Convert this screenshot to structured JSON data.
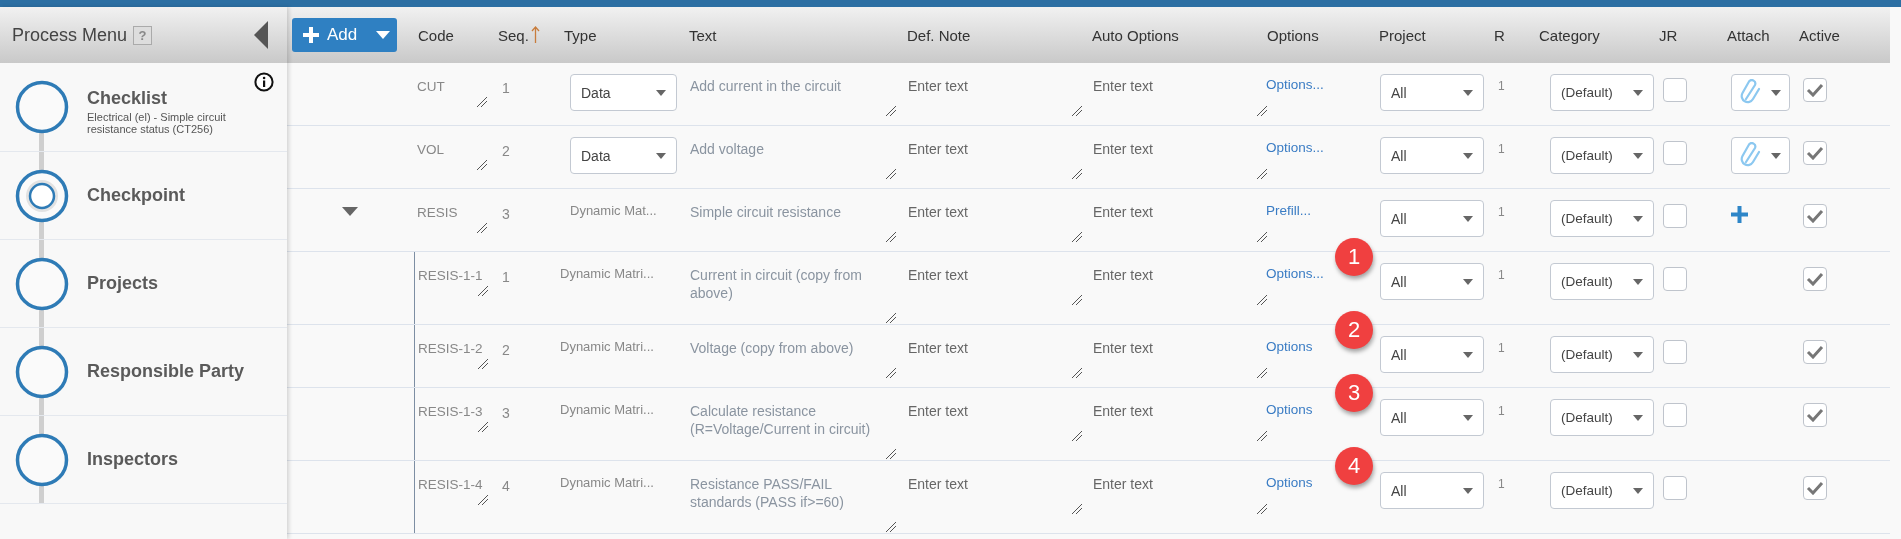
{
  "sidebar": {
    "title": "Process Menu",
    "help": "?",
    "items": [
      {
        "label": "Checklist",
        "subtitle": "Electrical (el) - Simple circuit resistance status (CT256)",
        "info": true,
        "selected": false
      },
      {
        "label": "Checkpoint",
        "selected": true
      },
      {
        "label": "Projects",
        "selected": false
      },
      {
        "label": "Responsible Party",
        "selected": false
      },
      {
        "label": "Inspectors",
        "selected": false
      }
    ]
  },
  "toolbar": {
    "add_button": "Add"
  },
  "table": {
    "columns": [
      {
        "label": "Code"
      },
      {
        "label": "Seq.",
        "sorted": true
      },
      {
        "label": "Type"
      },
      {
        "label": "Text"
      },
      {
        "label": "Def. Note"
      },
      {
        "label": "Auto Options"
      },
      {
        "label": "Options"
      },
      {
        "label": "Project"
      },
      {
        "label": "R"
      },
      {
        "label": "Category"
      },
      {
        "label": "JR"
      },
      {
        "label": "Attach"
      },
      {
        "label": "Active"
      }
    ],
    "rows": [
      {
        "code": "CUT",
        "seq": "1",
        "type": {
          "kind": "select",
          "value": "Data"
        },
        "text": "Add current in the circuit",
        "def_note": {
          "placeholder": "Enter text"
        },
        "auto_options": {
          "placeholder": "Enter text"
        },
        "options_link": "Options...",
        "project": "All",
        "r": "1",
        "category": "(Default)",
        "jr_checked": false,
        "attached": true,
        "active_checked": true
      },
      {
        "code": "VOL",
        "seq": "2",
        "type": {
          "kind": "select",
          "value": "Data"
        },
        "text": "Add voltage",
        "def_note": {
          "placeholder": "Enter text"
        },
        "auto_options": {
          "placeholder": "Enter text"
        },
        "options_link": "Options...",
        "project": "All",
        "r": "1",
        "category": "(Default)",
        "jr_checked": false,
        "attached": true,
        "active_checked": true
      },
      {
        "code": "RESIS",
        "seq": "3",
        "type": {
          "kind": "text",
          "value": "Dynamic Mat..."
        },
        "text": "Simple circuit resistance",
        "def_note": {
          "placeholder": "Enter text"
        },
        "auto_options": {
          "placeholder": "Enter text"
        },
        "options_link": "Prefill...",
        "project": "All",
        "r": "1",
        "category": "(Default)",
        "jr_checked": false,
        "attached": false,
        "active_checked": true,
        "expanded": true,
        "children": [
          {
            "code": "RESIS-1-1",
            "seq": "1",
            "type": {
              "kind": "text",
              "value": "Dynamic Matri..."
            },
            "text": "Current in circuit (copy from above)",
            "def_note": {
              "placeholder": "Enter text"
            },
            "auto_options": {
              "placeholder": "Enter text"
            },
            "options_link": "Options...",
            "badge": "1",
            "project": "All",
            "r": "1",
            "category": "(Default)",
            "jr_checked": false,
            "active_checked": true
          },
          {
            "code": "RESIS-1-2",
            "seq": "2",
            "type": {
              "kind": "text",
              "value": "Dynamic Matri..."
            },
            "text": "Voltage (copy from above)",
            "def_note": {
              "placeholder": "Enter text"
            },
            "auto_options": {
              "placeholder": "Enter text"
            },
            "options_link": "Options",
            "badge": "2",
            "project": "All",
            "r": "1",
            "category": "(Default)",
            "jr_checked": false,
            "active_checked": true
          },
          {
            "code": "RESIS-1-3",
            "seq": "3",
            "type": {
              "kind": "text",
              "value": "Dynamic Matri..."
            },
            "text": "Calculate resistance (R=Voltage/Current in circuit)",
            "def_note": {
              "placeholder": "Enter text"
            },
            "auto_options": {
              "placeholder": "Enter text"
            },
            "options_link": "Options",
            "badge": "3",
            "project": "All",
            "r": "1",
            "category": "(Default)",
            "jr_checked": false,
            "active_checked": true
          },
          {
            "code": "RESIS-1-4",
            "seq": "4",
            "type": {
              "kind": "text",
              "value": "Dynamic Matri..."
            },
            "text": "Resistance PASS/FAIL standards (PASS if>=60)",
            "def_note": {
              "placeholder": "Enter text"
            },
            "auto_options": {
              "placeholder": "Enter text"
            },
            "options_link": "Options",
            "badge": "4",
            "project": "All",
            "r": "1",
            "category": "(Default)",
            "jr_checked": false,
            "active_checked": true
          }
        ]
      }
    ]
  }
}
